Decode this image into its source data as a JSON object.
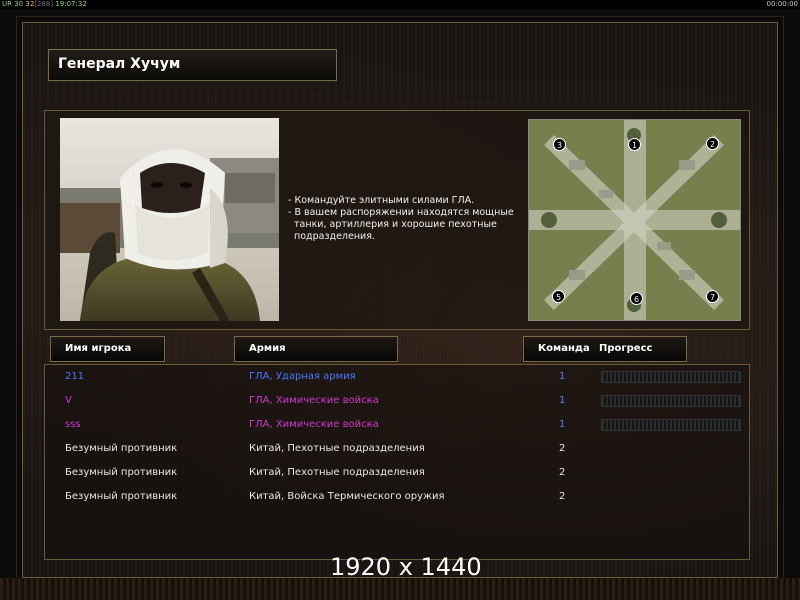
{
  "topbar": {
    "left_a": "UR 30",
    "left_b": "32",
    "left_c": "[288]",
    "left_d": "19:07:32",
    "right": "00:00:00"
  },
  "general": {
    "name": "Генерал Хучум"
  },
  "description": [
    "- Командуйте элитными силами ГЛА.",
    "- В вашем распоряжении находятся мощные",
    "танки, артиллерия и хорошие пехотные",
    "подразделения."
  ],
  "minimap": {
    "markers": [
      "3",
      "1",
      "2",
      "5",
      "6",
      "7"
    ]
  },
  "headers": {
    "player": "Имя игрока",
    "army": "Армия",
    "team": "Команда",
    "progress": "Прогресс"
  },
  "players": [
    {
      "name": "211",
      "army": "ГЛА, Ударная армия",
      "team": "1",
      "color": "#4a78ff"
    },
    {
      "name": "V",
      "army": "ГЛА, Химические войска",
      "team": "1",
      "color": "#d03ad0"
    },
    {
      "name": "sss",
      "army": "ГЛА, Химические войска",
      "team": "1",
      "color": "#d03ad0"
    },
    {
      "name": "Безумный противник",
      "army": "Китай, Пехотные подразделения",
      "team": "2",
      "color": "#e8e8e8"
    },
    {
      "name": "Безумный противник",
      "army": "Китай, Пехотные подразделения",
      "team": "2",
      "color": "#e8e8e8"
    },
    {
      "name": "Безумный противник",
      "army": "Китай, Войска Термического оружия",
      "team": "2",
      "color": "#e8e8e8"
    }
  ],
  "resolution_label": "1920 x 1440",
  "colors": {
    "gold_border": "#7a6a4a",
    "team1_blue": "#4a78ff",
    "team1_purple": "#d03ad0",
    "team_number_blue": "#5b7cff"
  }
}
